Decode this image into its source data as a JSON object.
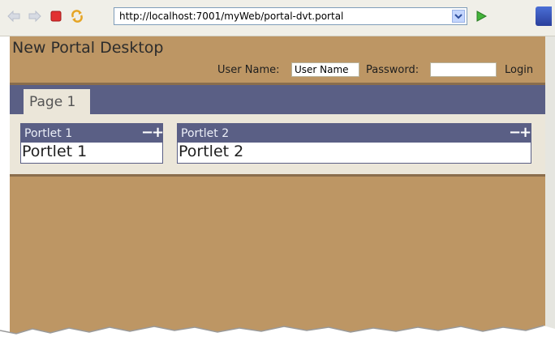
{
  "browser": {
    "url": "http://localhost:7001/myWeb/portal-dvt.portal",
    "icons": [
      "back-arrow-icon",
      "forward-arrow-icon",
      "stop-icon",
      "refresh-icon",
      "dropdown-arrow-icon",
      "go-icon",
      "browser-logo-icon"
    ]
  },
  "portal": {
    "desktop_title": "New Portal Desktop",
    "login": {
      "username_label": "User Name:",
      "username_value": "User Name",
      "password_label": "Password:",
      "password_value": "",
      "login_label": "Login"
    },
    "tabs": [
      {
        "label": "Page 1",
        "selected": true
      }
    ],
    "portlets": [
      {
        "title": "Portlet 1",
        "minimize": "−",
        "maximize": "+",
        "body": "Portlet 1"
      },
      {
        "title": "Portlet 2",
        "minimize": "−",
        "maximize": "+",
        "body": "Portlet 2"
      }
    ]
  },
  "colors": {
    "background": "#bd9664",
    "tab_bar": "#5a5f85",
    "content": "#ebe6d9"
  }
}
